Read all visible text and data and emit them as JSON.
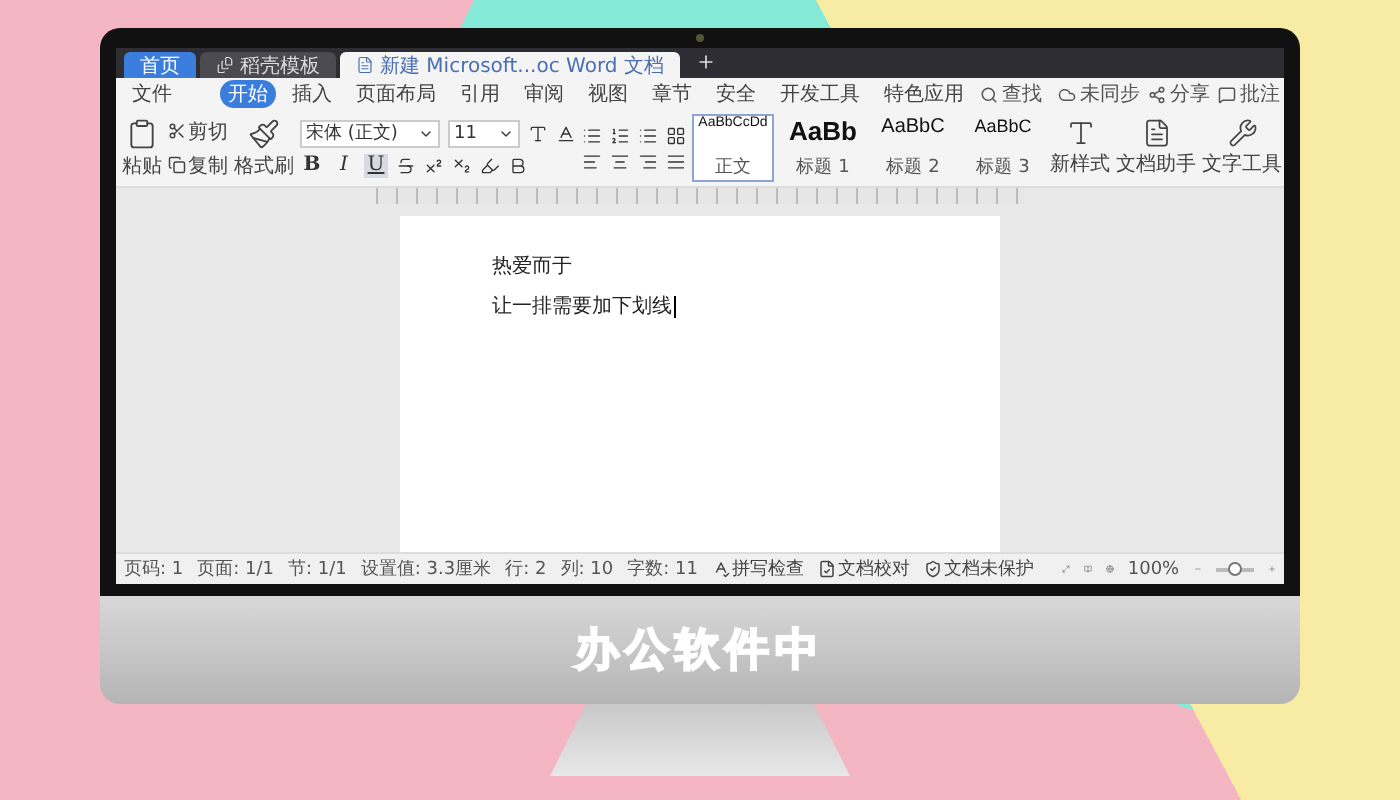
{
  "browser_tabs": [
    {
      "label": "首页",
      "selected": false,
      "kind": "home"
    },
    {
      "label": "稻壳模板",
      "selected": false,
      "kind": "template"
    },
    {
      "label": "新建 Microsoft...oc Word 文档",
      "selected": true,
      "kind": "doc"
    }
  ],
  "menu": {
    "file": "文件",
    "tabs": [
      {
        "label": "开始",
        "selected": true
      },
      {
        "label": "插入",
        "selected": false
      },
      {
        "label": "页面布局",
        "selected": false
      },
      {
        "label": "引用",
        "selected": false
      },
      {
        "label": "审阅",
        "selected": false
      },
      {
        "label": "视图",
        "selected": false
      },
      {
        "label": "章节",
        "selected": false
      },
      {
        "label": "安全",
        "selected": false
      },
      {
        "label": "开发工具",
        "selected": false
      },
      {
        "label": "特色应用",
        "selected": false
      }
    ],
    "search": "查找",
    "actions": [
      "未同步",
      "分享",
      "批注"
    ]
  },
  "ribbon": {
    "paste": "粘贴",
    "clipboard": [
      "剪切",
      "复制"
    ],
    "format_painter": "格式刷",
    "font_name": "宋体 (正文)",
    "font_size": "11",
    "bold": "B",
    "italic": "I",
    "underline": "U",
    "styles": [
      {
        "preview": "AaBbCcDd",
        "label": "正文",
        "selected": true,
        "kind": "small"
      },
      {
        "preview": "AaBb",
        "label": "标题 1",
        "selected": false,
        "kind": "large"
      },
      {
        "preview": "AaBbC",
        "label": "标题 2",
        "selected": false,
        "kind": "medium"
      },
      {
        "preview": "AaBbC",
        "label": "标题 3",
        "selected": false,
        "kind": "normal"
      }
    ],
    "tools": [
      {
        "label": "新样式",
        "kind": "style"
      },
      {
        "label": "文档助手",
        "kind": "doc"
      },
      {
        "label": "文字工具",
        "kind": "wrench"
      }
    ]
  },
  "document": {
    "lines": [
      "热爱而于",
      "让一排需要加下划线"
    ]
  },
  "status_bar": {
    "items": [
      "页码: 1",
      "页面: 1/1",
      "节: 1/1",
      "设置值: 3.3厘米",
      "行: 2",
      "列: 10",
      "字数: 11"
    ],
    "checks": [
      {
        "label": "拼写检查",
        "kind": "spell"
      },
      {
        "label": "文档校对",
        "kind": "proof"
      },
      {
        "label": "文档未保护",
        "kind": "shield"
      }
    ],
    "zoom": "100%",
    "level": 0.5
  },
  "caption": "办公软件中"
}
